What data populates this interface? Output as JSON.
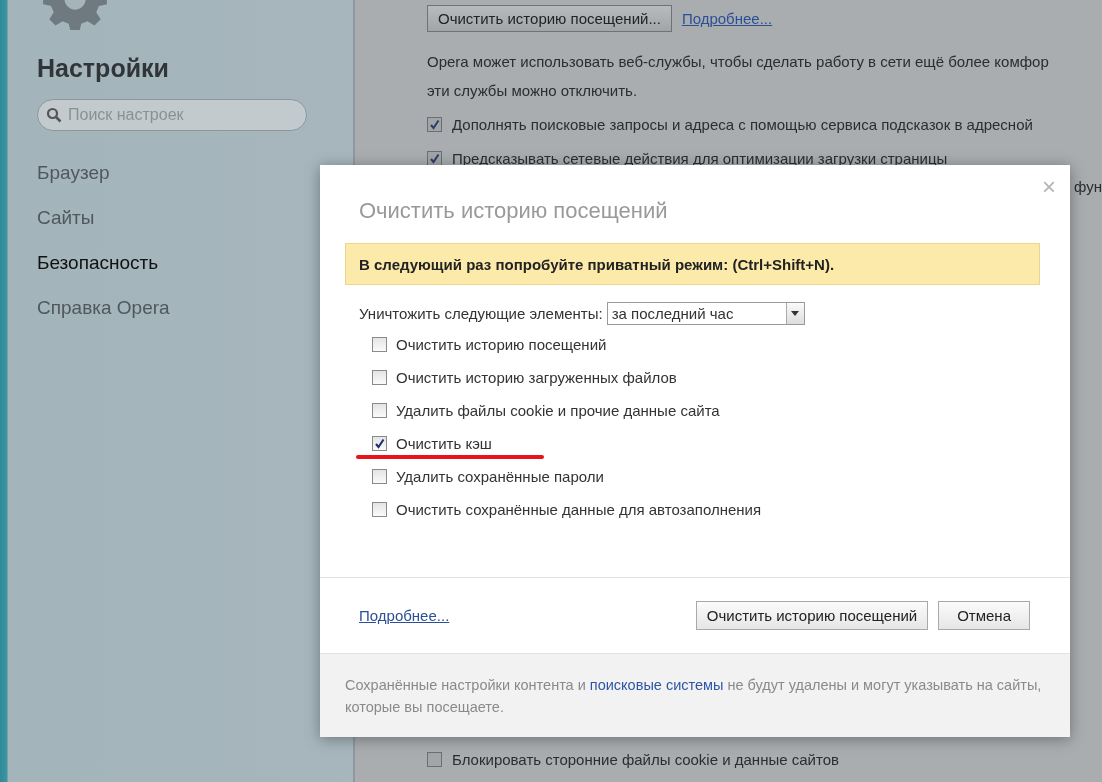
{
  "sidebar": {
    "title": "Настройки",
    "search": {
      "placeholder": "Поиск настроек"
    },
    "items": [
      {
        "label": "Браузер",
        "selected": false
      },
      {
        "label": "Сайты",
        "selected": false
      },
      {
        "label": "Безопасность",
        "selected": true
      },
      {
        "label": "Справка Opera",
        "selected": false
      }
    ]
  },
  "main": {
    "clear_button": "Очистить историю посещений...",
    "more_link": "Подробнее...",
    "text_lines": [
      "Opera может использовать веб-службы, чтобы сделать работу в сети ещё более комфор",
      "эти службы можно отключить."
    ],
    "options": [
      {
        "label": "Дополнять поисковые запросы и адреса с помощью сервиса подсказок в адресной",
        "checked": true
      },
      {
        "label": "Предсказывать сетевые действия для оптимизации загрузки страницы",
        "checked": true
      }
    ],
    "side_fragment": "фун",
    "bottom_options": [
      {
        "label": "Блокировать сторонние файлы cookie и данные сайтов",
        "checked": false
      }
    ]
  },
  "dialog": {
    "title": "Очистить историю посещений",
    "close": "×",
    "notice": "В следующий раз попробуйте приватный режим: (Ctrl+Shift+N).",
    "period_label": "Уничтожить следующие элементы:",
    "period_value": "за последний час",
    "items": [
      {
        "label": "Очистить историю посещений",
        "checked": false,
        "underlined": false
      },
      {
        "label": "Очистить историю загруженных файлов",
        "checked": false,
        "underlined": false
      },
      {
        "label": "Удалить файлы cookie и прочие данные сайта",
        "checked": false,
        "underlined": false
      },
      {
        "label": "Очистить кэш",
        "checked": true,
        "underlined": true
      },
      {
        "label": "Удалить сохранённые пароли",
        "checked": false,
        "underlined": false
      },
      {
        "label": "Очистить сохранённые данные для автозаполнения",
        "checked": false,
        "underlined": false
      }
    ],
    "footer_link": "Подробнее...",
    "confirm_button": "Очистить историю посещений",
    "cancel_button": "Отмена",
    "note_before": "Сохранённые настройки контента и ",
    "note_link": "поисковые системы",
    "note_after": " не будут удалены и могут указывать на сайты, которые вы посещаете."
  }
}
